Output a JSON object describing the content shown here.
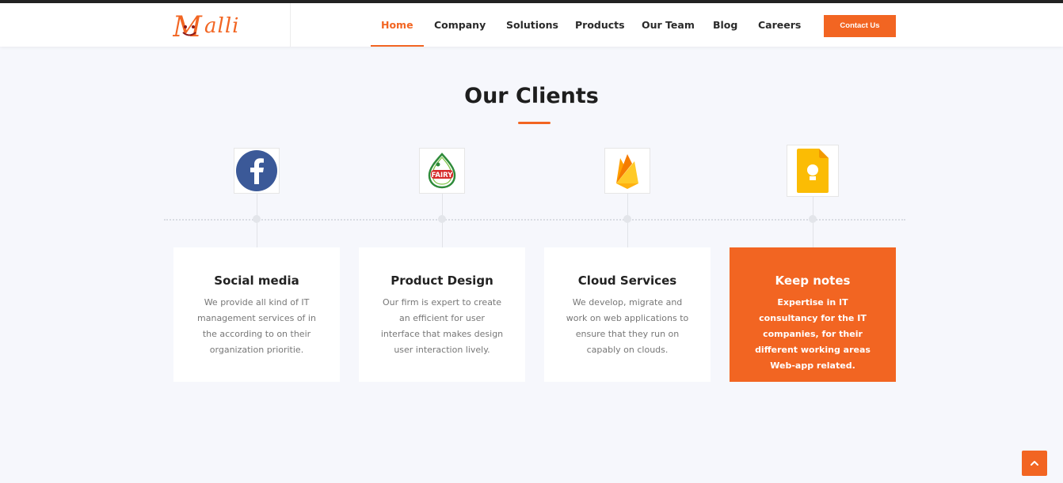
{
  "header": {
    "logo_text": "Malli",
    "nav": [
      {
        "label": "Home",
        "active": true
      },
      {
        "label": "Company",
        "active": false
      },
      {
        "label": "Solutions",
        "active": false
      },
      {
        "label": "Products",
        "active": false
      },
      {
        "label": "Our Team",
        "active": false
      },
      {
        "label": "Blog",
        "active": false
      },
      {
        "label": "Careers",
        "active": false
      }
    ],
    "contact_label": "Contact Us"
  },
  "section": {
    "title": "Our Clients"
  },
  "clients": [
    {
      "logo": "facebook-logo",
      "title": "Social media",
      "desc": "We provide all kind of IT management services of in the according to on their organization prioritie.",
      "highlight": false
    },
    {
      "logo": "fairy-logo",
      "title": "Product Design",
      "desc": "Our firm is expert to create an efficient for user interface that makes design user interaction lively.",
      "highlight": false
    },
    {
      "logo": "firebase-logo",
      "title": "Cloud Services",
      "desc": "We develop, migrate and work on web applications to ensure that they run on capably on clouds.",
      "highlight": false
    },
    {
      "logo": "google-keep-logo",
      "title": "Keep notes",
      "desc": "Expertise in IT consultancy for the IT companies, for their different working areas Web-app related.",
      "highlight": true
    }
  ],
  "colors": {
    "accent": "#f26522",
    "background": "#f6f7fc"
  },
  "scroll_top_icon": "chevron-up-icon"
}
